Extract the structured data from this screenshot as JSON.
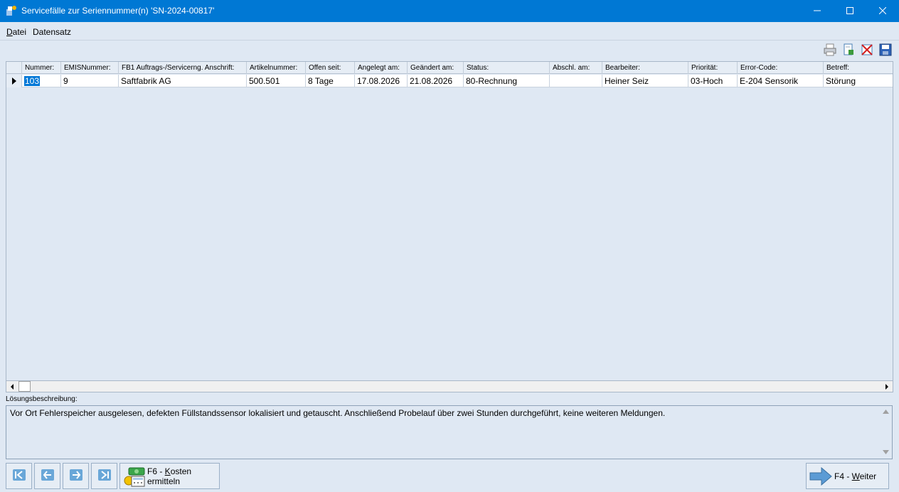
{
  "window": {
    "title": "Servicefälle zur Seriennummer(n) 'SN-2024-00817'",
    "controls": [
      "minimize-icon",
      "maximize-icon",
      "close-icon"
    ]
  },
  "menu": {
    "datei_first": "D",
    "datei_rest": "atei",
    "datensatz": "Datensatz"
  },
  "toolbar": {
    "icons": [
      "printer-icon",
      "export-sheet-icon",
      "delete-icon",
      "save-icon"
    ]
  },
  "grid": {
    "headers": {
      "nummer": "Nummer:",
      "emis": "EMISNummer:",
      "fb1": "FB1 Auftrags-/Servicerng. Anschrift:",
      "artikel": "Artikelnummer:",
      "offen": "Offen seit:",
      "angelegt": "Angelegt am:",
      "geaendert": "Geändert am:",
      "status": "Status:",
      "abschl": "Abschl. am:",
      "bearbeiter": "Bearbeiter:",
      "prioritaet": "Priorität:",
      "error": "Error-Code:",
      "betreff": "Betreff:"
    },
    "row": {
      "nummer": "103",
      "emis": "9",
      "fb1": "Saftfabrik AG",
      "artikel": "500.501",
      "offen": "8 Tage",
      "angelegt": "17.08.2026",
      "geaendert": "21.08.2026",
      "status": "80-Rechnung",
      "abschl": "",
      "bearbeiter": "Heiner Seiz",
      "prioritaet": "03-Hoch",
      "error": "E-204 Sensorik",
      "betreff": "Störung"
    }
  },
  "description": {
    "label": "Lösungsbeschreibung:",
    "text": "Vor Ort Fehlerspeicher ausgelesen, defekten Füllstandssensor lokalisiert und getauscht. Anschließend Probelauf über zwei Stunden durchgeführt, keine weiteren Meldungen."
  },
  "buttons": {
    "kosten_prefix": "F6 - ",
    "kosten_underlined": "K",
    "kosten_rest": "osten",
    "kosten_line2": "ermitteln",
    "weiter_prefix": "F4 - ",
    "weiter_underlined": "W",
    "weiter_rest": "eiter"
  },
  "colors": {
    "titlebar": "#0078d4",
    "window_bg": "#dfe8f3",
    "selection": "#0078d7"
  }
}
